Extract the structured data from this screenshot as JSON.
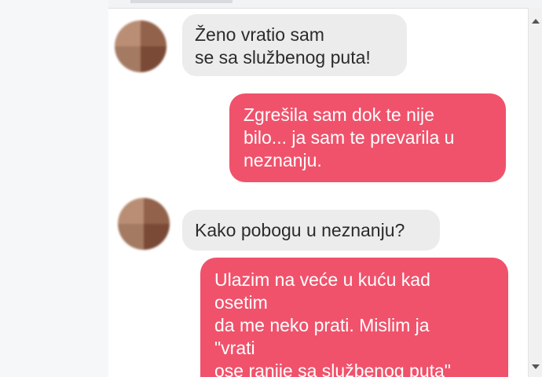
{
  "colors": {
    "outgoing_bubble": "#f0526b",
    "incoming_bubble": "#ececec",
    "outgoing_text": "#ffffff",
    "incoming_text": "#2b2b2b"
  },
  "messages": [
    {
      "direction": "incoming",
      "text": "Ženo vratio sam\nse sa službenog puta!"
    },
    {
      "direction": "outgoing",
      "text": "Zgrešila sam dok te nije\nbilo... ja sam te prevarila u\nneznanju."
    },
    {
      "direction": "incoming",
      "text": "Kako pobogu u neznanju?"
    },
    {
      "direction": "outgoing",
      "text": "Ulazim na veće u kuću kad\nosetim\nda me neko prati. Mislim ja\n\"vrati\nose ranije sa službenog puta\""
    }
  ]
}
